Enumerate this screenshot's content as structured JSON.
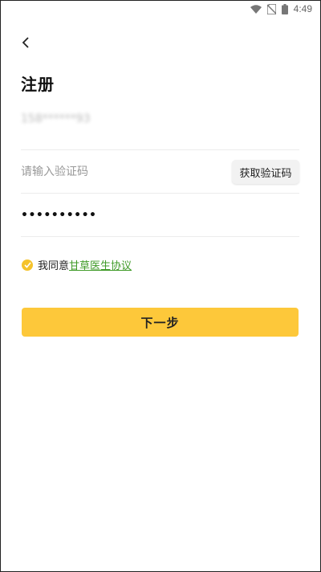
{
  "status_bar": {
    "time": "4:49",
    "icons": [
      "wifi-icon",
      "no-sim-icon",
      "battery-icon"
    ]
  },
  "page": {
    "title": "注册"
  },
  "form": {
    "phone_value": "158******93",
    "code_placeholder": "请输入验证码",
    "get_code_label": "获取验证码",
    "password_masked": "••••••••••"
  },
  "agreement": {
    "checked": true,
    "prefix": "我同意",
    "link_text": "甘草医生协议"
  },
  "actions": {
    "next_label": "下一步"
  },
  "colors": {
    "primary": "#fdc83a",
    "check": "#f5c32c",
    "link": "#3f9a27"
  }
}
